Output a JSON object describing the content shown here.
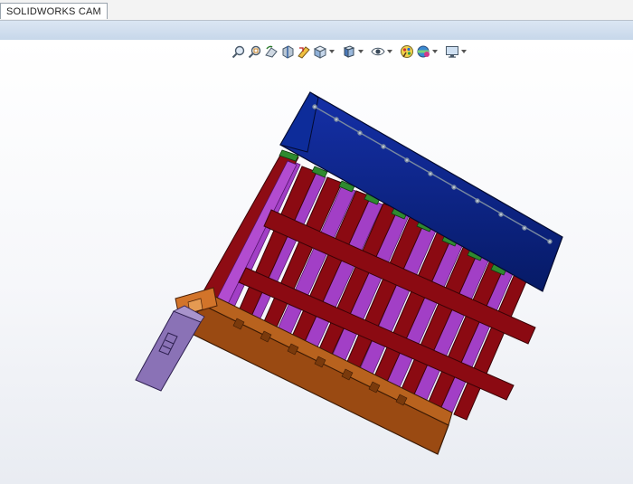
{
  "window": {
    "tab_label": "SOLIDWORKS CAM"
  },
  "heads_up_toolbar": {
    "buttons": [
      {
        "name": "zoom-to-fit",
        "icon": "magnifier-fit-icon"
      },
      {
        "name": "zoom-to-area",
        "icon": "magnifier-area-icon"
      },
      {
        "name": "previous-view",
        "icon": "previous-view-icon"
      },
      {
        "name": "section-view",
        "icon": "section-view-icon"
      },
      {
        "name": "dynamic-annotation-views",
        "icon": "annotation-view-icon"
      },
      {
        "name": "view-orientation",
        "icon": "view-orientation-icon",
        "dropdown": true
      },
      {
        "name": "display-style",
        "icon": "display-style-cube-icon",
        "dropdown": true
      },
      {
        "name": "hide-show-items",
        "icon": "eye-icon",
        "dropdown": true
      },
      {
        "name": "edit-appearance",
        "icon": "appearance-icon"
      },
      {
        "name": "apply-scene",
        "icon": "scene-icon",
        "dropdown": true
      },
      {
        "name": "view-settings",
        "icon": "monitor-icon",
        "dropdown": true
      }
    ]
  },
  "colors": {
    "ribbon": "#c9d9ec",
    "top_block": "#0a1f7a",
    "frame_red": "#8b0a12",
    "slot_purple": "#a640c8",
    "base_brown": "#9a4a12",
    "handle_purple": "#8a72b6",
    "clip_green": "#2f8a2f"
  }
}
